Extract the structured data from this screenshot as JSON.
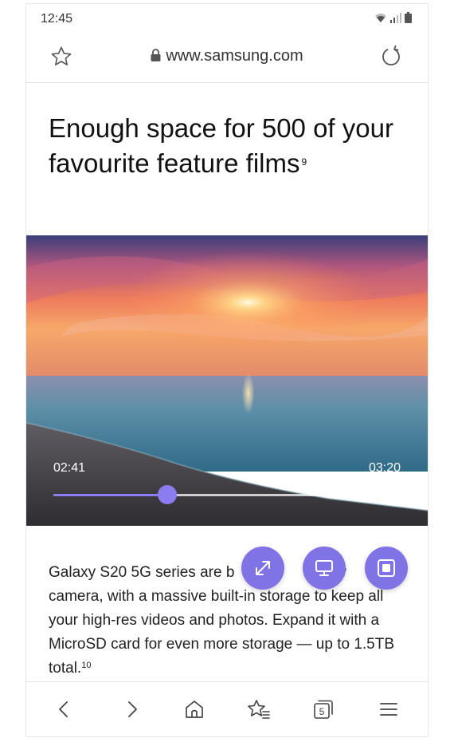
{
  "status_bar": {
    "time": "12:45"
  },
  "browser": {
    "url": "www.samsung.com",
    "tab_count": "5"
  },
  "content": {
    "headline": "Enough space for 500 of your favourite feature films",
    "headline_footnote": "9",
    "body": "Galaxy S20 5G series are b    ou      ow  camera, with a massive built-in storage to keep all your high-res videos and photos. Expand it with a MicroSD card for even more storage — up to 1.5TB total.",
    "body_footnote": "10"
  },
  "video": {
    "current_time": "02:41",
    "total_time": "03:20",
    "progress": 0.328,
    "accent_color": "#8b7cf0"
  },
  "floating_buttons": {
    "color": "#7f73e6",
    "icons": [
      "expand-icon",
      "screen-icon",
      "popup-play-icon"
    ]
  },
  "bottom_nav": {
    "icons": [
      "back-icon",
      "forward-icon",
      "home-icon",
      "bookmarks-icon",
      "tabs-icon",
      "menu-icon"
    ]
  }
}
